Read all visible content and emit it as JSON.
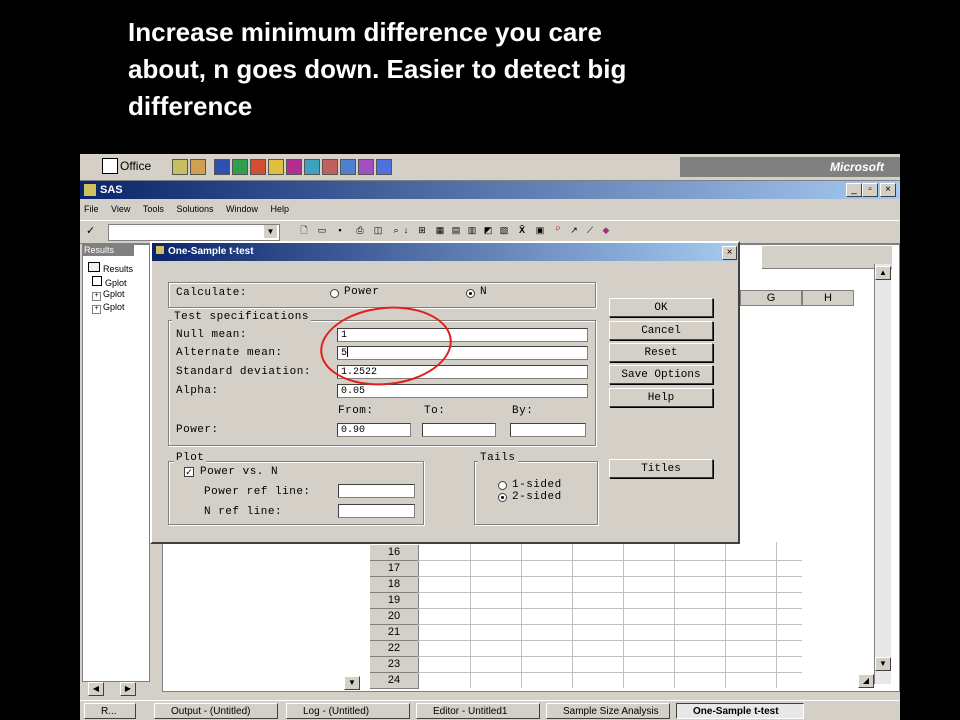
{
  "caption": {
    "line1": "Increase minimum difference you care",
    "line2": "about, n goes down.  Easier to detect big",
    "line3": "difference"
  },
  "office_bar": {
    "label": "Office",
    "right_label": "Microsoft"
  },
  "app": {
    "title": "SAS"
  },
  "menu": [
    "File",
    "View",
    "Tools",
    "Solutions",
    "Window",
    "Help"
  ],
  "results_panel": {
    "tab": "Results",
    "root": "Results",
    "items": [
      "Gplot",
      "Gplot",
      "Gplot"
    ]
  },
  "grid": {
    "column_headers": [
      "G",
      "H"
    ],
    "rows": [
      "16",
      "17",
      "18",
      "19",
      "20",
      "21",
      "22",
      "23",
      "24"
    ]
  },
  "dialog": {
    "title": "One-Sample t-test",
    "calculate_label": "Calculate:",
    "options": {
      "power": "Power",
      "n": "N"
    },
    "selected": "N",
    "test_spec_label": "Test specifications",
    "fields": {
      "null_mean": {
        "label": "Null mean:",
        "value": "1"
      },
      "alt_mean": {
        "label": "Alternate mean:",
        "value": "5"
      },
      "sd": {
        "label": "Standard deviation:",
        "value": "1.2522"
      },
      "alpha": {
        "label": "Alpha:",
        "value": "0.05"
      }
    },
    "range_headers": {
      "from": "From:",
      "to": "To:",
      "by": "By:"
    },
    "power": {
      "label": "Power:",
      "from": "0.90",
      "to": "",
      "by": ""
    },
    "plot": {
      "label": "Plot",
      "power_vs_n": "Power vs. N",
      "power_vs_n_checked": true,
      "power_ref_line": {
        "label": "Power ref line:",
        "value": ""
      },
      "n_ref_line": {
        "label": "N ref line:",
        "value": ""
      }
    },
    "tails": {
      "label": "Tails",
      "one_sided": "1-sided",
      "two_sided": "2-sided",
      "selected": "2-sided"
    },
    "buttons": {
      "ok": "OK",
      "cancel": "Cancel",
      "reset": "Reset",
      "save_options": "Save Options",
      "help": "Help",
      "titles": "Titles"
    }
  },
  "taskbar": {
    "left_label": "R...",
    "tasks": [
      "Output - (Untitled)",
      "Log - (Untitled)",
      "Editor - Untitled1",
      "Sample Size Analysis",
      "One-Sample t-test"
    ],
    "active": "One-Sample t-test"
  },
  "colors": {
    "highlight": "#e0201c",
    "titlebar": "#0a246a",
    "chrome": "#d4d0c8"
  }
}
